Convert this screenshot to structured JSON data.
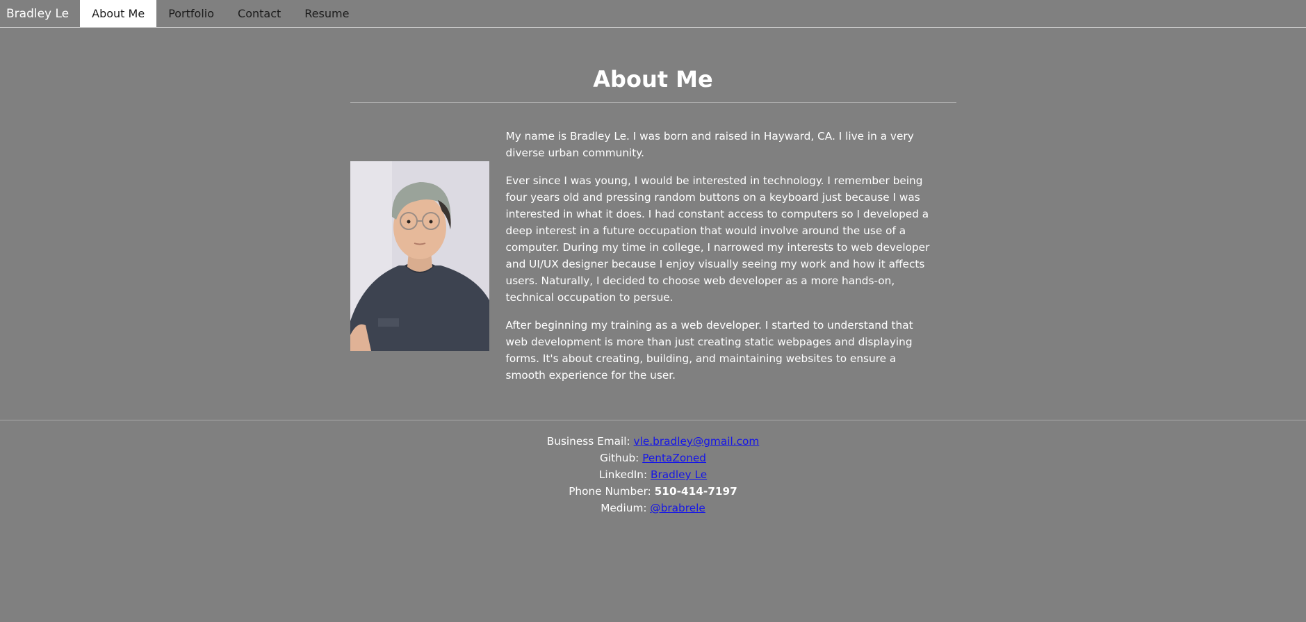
{
  "nav": {
    "brand": "Bradley Le",
    "items": [
      {
        "label": "About Me"
      },
      {
        "label": "Portfolio"
      },
      {
        "label": "Contact"
      },
      {
        "label": "Resume"
      }
    ]
  },
  "main": {
    "title": "About Me",
    "paragraphs": [
      "My name is Bradley Le. I was born and raised in Hayward, CA. I live in a very diverse urban community.",
      "Ever since I was young, I would be interested in technology. I remember being four years old and pressing random buttons on a keyboard just because I was interested in what it does. I had constant access to computers so I developed a deep interest in a future occupation that would involve around the use of a computer. During my time in college, I narrowed my interests to web developer and UI/UX designer because I enjoy visually seeing my work and how it affects users. Naturally, I decided to choose web developer as a more hands-on, technical occupation to persue.",
      "After beginning my training as a web developer. I started to understand that web development is more than just creating static webpages and displaying forms. It's about creating, building, and maintaining websites to ensure a smooth experience for the user."
    ]
  },
  "footer": {
    "email_label": "Business Email: ",
    "email_value": "vle.bradley@gmail.com",
    "github_label": "Github: ",
    "github_value": "PentaZoned",
    "linkedin_label": "LinkedIn: ",
    "linkedin_value": "Bradley Le",
    "phone_label": "Phone Number: ",
    "phone_value": "510-414-7197",
    "medium_label": "Medium: ",
    "medium_value": "@brabrele"
  },
  "colors": {
    "background": "#808080",
    "link": "#1515e8",
    "active_tab": "#ffffff"
  }
}
